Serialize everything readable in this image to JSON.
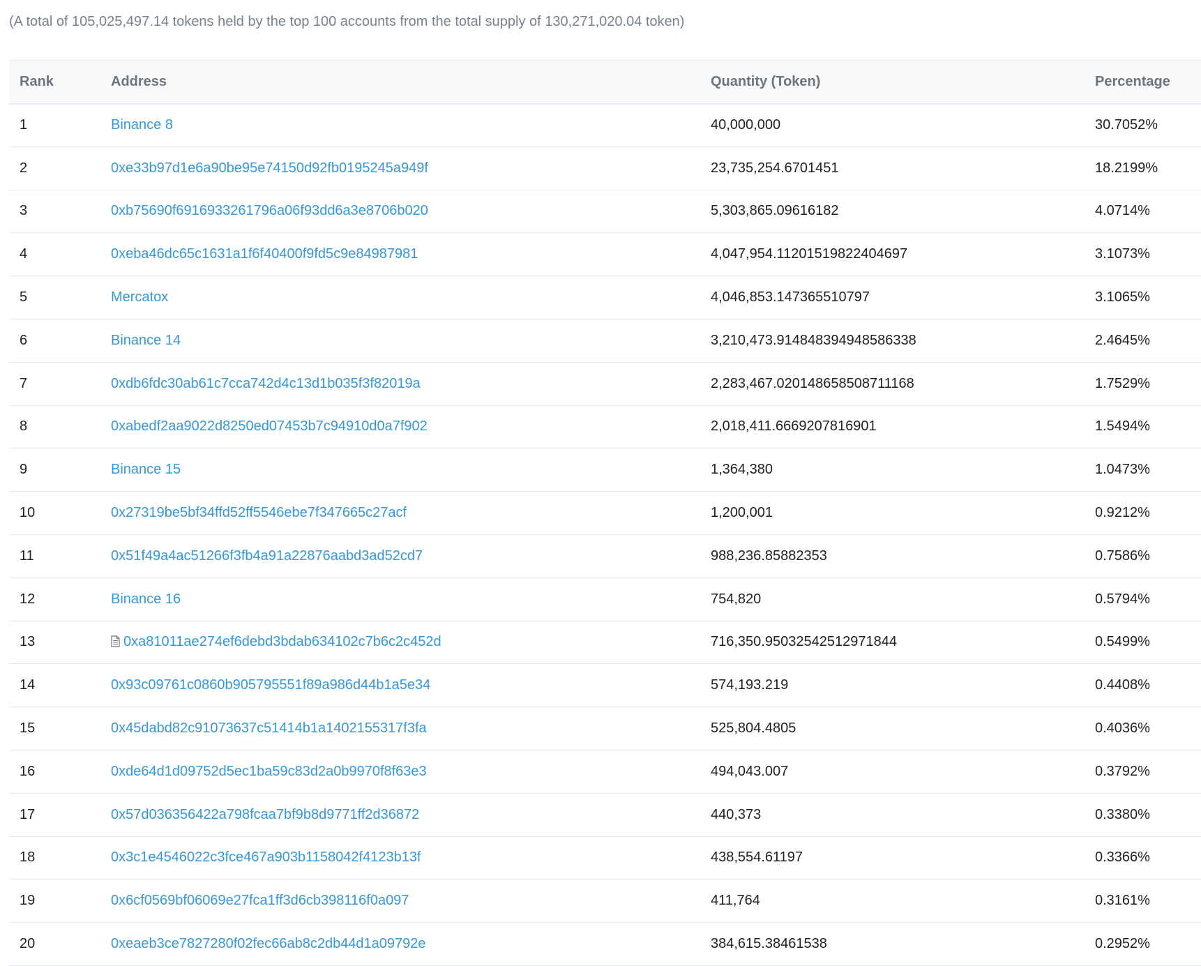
{
  "summary": "(A total of 105,025,497.14 tokens held by the top 100 accounts from the total supply of 130,271,020.04 token)",
  "table": {
    "headers": {
      "rank": "Rank",
      "address": "Address",
      "quantity": "Quantity (Token)",
      "percentage": "Percentage"
    },
    "rows": [
      {
        "rank": "1",
        "address": "Binance 8",
        "quantity": "40,000,000",
        "percentage": "30.7052%",
        "contract": false
      },
      {
        "rank": "2",
        "address": "0xe33b97d1e6a90be95e74150d92fb0195245a949f",
        "quantity": "23,735,254.6701451",
        "percentage": "18.2199%",
        "contract": false
      },
      {
        "rank": "3",
        "address": "0xb75690f6916933261796a06f93dd6a3e8706b020",
        "quantity": "5,303,865.09616182",
        "percentage": "4.0714%",
        "contract": false
      },
      {
        "rank": "4",
        "address": "0xeba46dc65c1631a1f6f40400f9fd5c9e84987981",
        "quantity": "4,047,954.11201519822404697",
        "percentage": "3.1073%",
        "contract": false
      },
      {
        "rank": "5",
        "address": "Mercatox",
        "quantity": "4,046,853.147365510797",
        "percentage": "3.1065%",
        "contract": false
      },
      {
        "rank": "6",
        "address": "Binance 14",
        "quantity": "3,210,473.914848394948586338",
        "percentage": "2.4645%",
        "contract": false
      },
      {
        "rank": "7",
        "address": "0xdb6fdc30ab61c7cca742d4c13d1b035f3f82019a",
        "quantity": "2,283,467.020148658508711168",
        "percentage": "1.7529%",
        "contract": false
      },
      {
        "rank": "8",
        "address": "0xabedf2aa9022d8250ed07453b7c94910d0a7f902",
        "quantity": "2,018,411.6669207816901",
        "percentage": "1.5494%",
        "contract": false
      },
      {
        "rank": "9",
        "address": "Binance 15",
        "quantity": "1,364,380",
        "percentage": "1.0473%",
        "contract": false
      },
      {
        "rank": "10",
        "address": "0x27319be5bf34ffd52ff5546ebe7f347665c27acf",
        "quantity": "1,200,001",
        "percentage": "0.9212%",
        "contract": false
      },
      {
        "rank": "11",
        "address": "0x51f49a4ac51266f3fb4a91a22876aabd3ad52cd7",
        "quantity": "988,236.85882353",
        "percentage": "0.7586%",
        "contract": false
      },
      {
        "rank": "12",
        "address": "Binance 16",
        "quantity": "754,820",
        "percentage": "0.5794%",
        "contract": false
      },
      {
        "rank": "13",
        "address": "0xa81011ae274ef6debd3bdab634102c7b6c2c452d",
        "quantity": "716,350.95032542512971844",
        "percentage": "0.5499%",
        "contract": true
      },
      {
        "rank": "14",
        "address": "0x93c09761c0860b905795551f89a986d44b1a5e34",
        "quantity": "574,193.219",
        "percentage": "0.4408%",
        "contract": false
      },
      {
        "rank": "15",
        "address": "0x45dabd82c91073637c51414b1a1402155317f3fa",
        "quantity": "525,804.4805",
        "percentage": "0.4036%",
        "contract": false
      },
      {
        "rank": "16",
        "address": "0xde64d1d09752d5ec1ba59c83d2a0b9970f8f63e3",
        "quantity": "494,043.007",
        "percentage": "0.3792%",
        "contract": false
      },
      {
        "rank": "17",
        "address": "0x57d036356422a798fcaa7bf9b8d9771ff2d36872",
        "quantity": "440,373",
        "percentage": "0.3380%",
        "contract": false
      },
      {
        "rank": "18",
        "address": "0x3c1e4546022c3fce467a903b1158042f4123b13f",
        "quantity": "438,554.61197",
        "percentage": "0.3366%",
        "contract": false
      },
      {
        "rank": "19",
        "address": "0x6cf0569bf06069e27fca1ff3d6cb398116f0a097",
        "quantity": "411,764",
        "percentage": "0.3161%",
        "contract": false
      },
      {
        "rank": "20",
        "address": "0xeaeb3ce7827280f02fec66ab8c2db44d1a09792e",
        "quantity": "384,615.38461538",
        "percentage": "0.2952%",
        "contract": false
      }
    ]
  },
  "icons": {
    "contract": "file-contract-icon"
  },
  "colors": {
    "link": "#3498db",
    "muted_text": "#77838f",
    "header_text": "#6c757d",
    "body_text": "#1e2022",
    "border": "#e7eaf3",
    "header_bg": "#f8f9fa"
  }
}
